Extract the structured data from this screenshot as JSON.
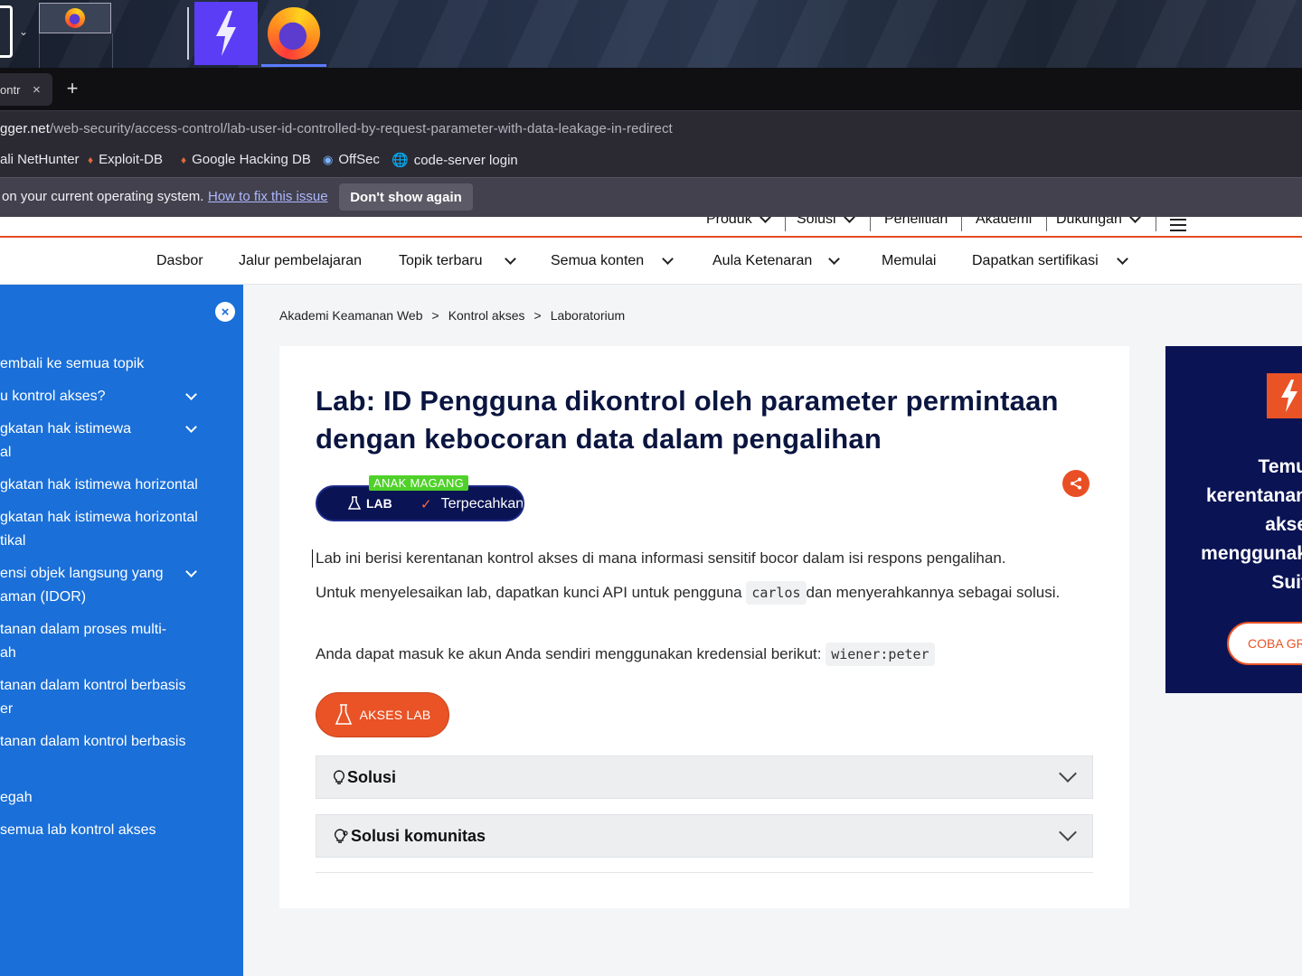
{
  "browser": {
    "tab_title": "ontr",
    "url_host": "gger.net",
    "url_path": "/web-security/access-control/lab-user-id-controlled-by-request-parameter-with-data-leakage-in-redirect",
    "bookmarks": [
      "ali NetHunter",
      "Exploit-DB",
      "Google Hacking DB",
      "OffSec",
      "code-server login"
    ],
    "notification": {
      "text": "on your current operating system.",
      "link": "How to fix this issue",
      "button": "Don't show again"
    }
  },
  "topnav": {
    "items": [
      "Produk",
      "Solusi",
      "Penelitian",
      "Akademi",
      "Dukungan"
    ]
  },
  "subnav": {
    "items": [
      "Dasbor",
      "Jalur pembelajaran",
      "Topik terbaru",
      "Semua konten",
      "Aula Ketenaran",
      "Memulai",
      "Dapatkan sertifikasi"
    ]
  },
  "sidebar": {
    "items": [
      "embali ke semua topik",
      "u kontrol akses?",
      "gkatan hak istimewa",
      "al",
      "gkatan hak istimewa horizontal",
      "gkatan hak istimewa horizontal",
      "tikal",
      "ensi objek langsung yang",
      "aman (IDOR)",
      "tanan dalam proses multi-",
      "ah",
      "tanan dalam kontrol berbasis",
      "er",
      "tanan dalam kontrol berbasis",
      "egah",
      "semua lab kontrol akses"
    ]
  },
  "breadcrumb": [
    "Akademi Keamanan Web",
    "Kontrol akses",
    "Laboratorium"
  ],
  "breadcrumb_sep": ">",
  "lab": {
    "title": "Lab: ID Pengguna dikontrol oleh parameter permintaan dengan kebocoran data dalam pengalihan",
    "level_badge": "ANAK MAGANG",
    "type_label": "LAB",
    "status": "Terpecahkan",
    "p1": "Lab ini berisi kerentanan kontrol akses di mana informasi sensitif bocor dalam isi respons pengalihan.",
    "p2_before": "Untuk menyelesaikan lab, dapatkan kunci API untuk pengguna",
    "p2_code": "carlos",
    "p2_after": "dan menyerahkannya sebagai solusi.",
    "p3_before": "Anda dapat masuk ke akun Anda sendiri menggunakan kredensial berikut:",
    "p3_code": "wiener:peter",
    "access_button": "AKSES LAB",
    "accordions": [
      "Solusi",
      "Solusi komunitas"
    ]
  },
  "promo": {
    "lines": [
      "Temu",
      "kerentanan",
      "akse",
      "menggunak",
      "Suit"
    ],
    "button": "COBA GR"
  },
  "colors": {
    "accent": "#e95326",
    "sidebar": "#1a6fd8",
    "navy": "#0a1354",
    "badge_green": "#4fd12a"
  }
}
